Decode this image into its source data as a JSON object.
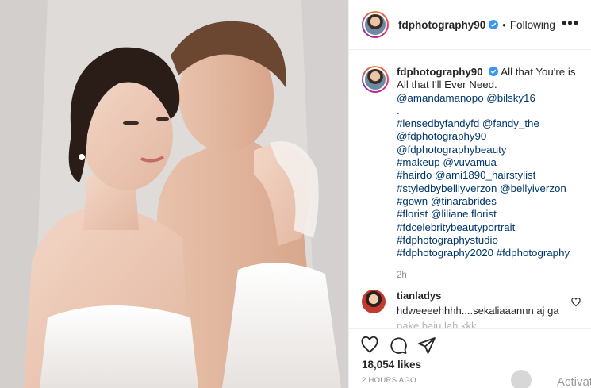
{
  "header": {
    "username": "fdphotography90",
    "separator": "•",
    "follow_label": "Following",
    "more_label": "•••"
  },
  "caption": {
    "username": "fdphotography90",
    "lines": [
      "All that You're is",
      "All that I'll Ever Need.",
      "@amandamanopo @bilsky16",
      ".",
      "#lensedbyfandyfd @fandy_the",
      "@fdphotography90",
      "@fdphotographybeauty",
      "#makeup @vuvamua",
      "#hairdo @ami1890_hairstylist",
      "#styledbybelliyverzon @bellyiverzon",
      "#gown @tinarabrides",
      "#florist @liliane.florist",
      "#fdcelebritybeautyportrait",
      "#fdphotographystudio",
      "#fdphotography2020 #fdphotography"
    ],
    "time": "2h"
  },
  "comment": {
    "username": "tianladys",
    "text": "hdweeeehhhh....sekaliaaannn aj ga",
    "text2": "pake baju lah kkk..."
  },
  "footer": {
    "likes": "18,054 likes",
    "posted": "2 HOURS AGO",
    "watermark": "Activate"
  },
  "colors": {
    "link": "#00376b",
    "verified": "#3897f0",
    "muted": "#8e8e8e"
  },
  "icons": [
    "heart-icon",
    "comment-icon",
    "share-icon",
    "verified-icon",
    "like-comment-icon"
  ]
}
